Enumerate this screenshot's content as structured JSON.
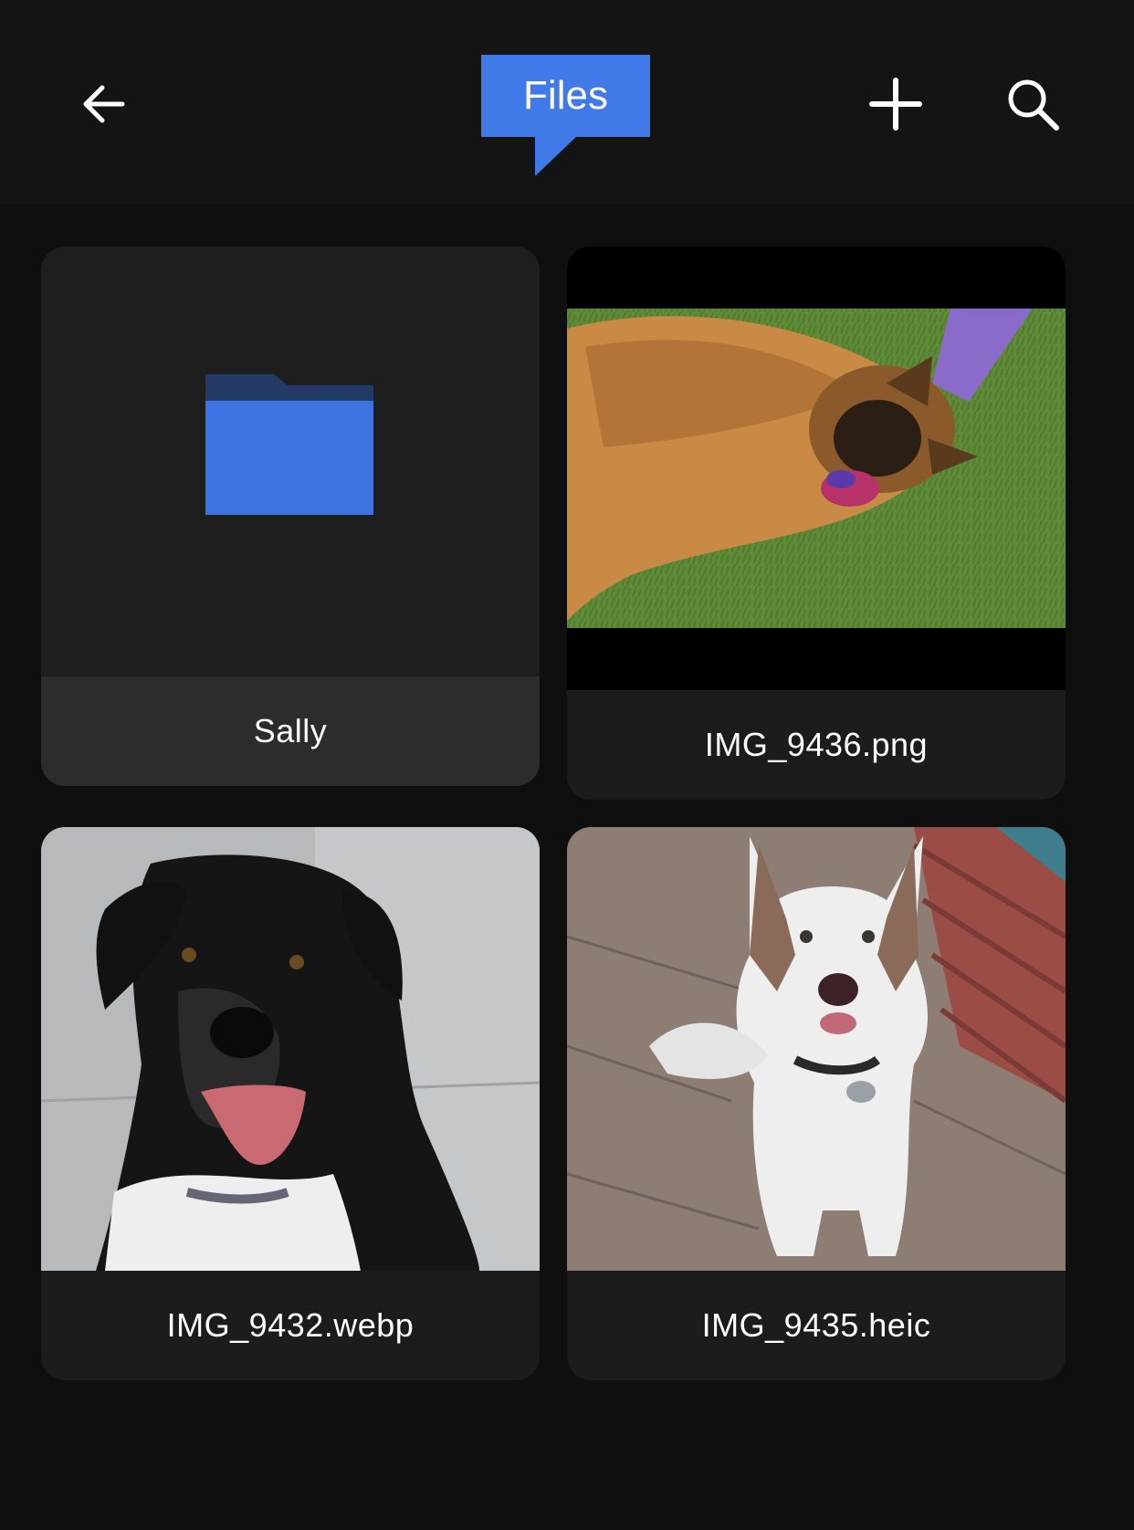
{
  "header": {
    "title": "Files",
    "back_icon": "arrow-left-icon",
    "add_icon": "plus-icon",
    "search_icon": "search-icon",
    "accent": "#3f7ae8"
  },
  "items": [
    {
      "type": "folder",
      "name": "Sally",
      "icon": "folder-icon"
    },
    {
      "type": "image",
      "name": "IMG_9436.png"
    },
    {
      "type": "image",
      "name": "IMG_9432.webp"
    },
    {
      "type": "image",
      "name": "IMG_9435.heic"
    }
  ]
}
